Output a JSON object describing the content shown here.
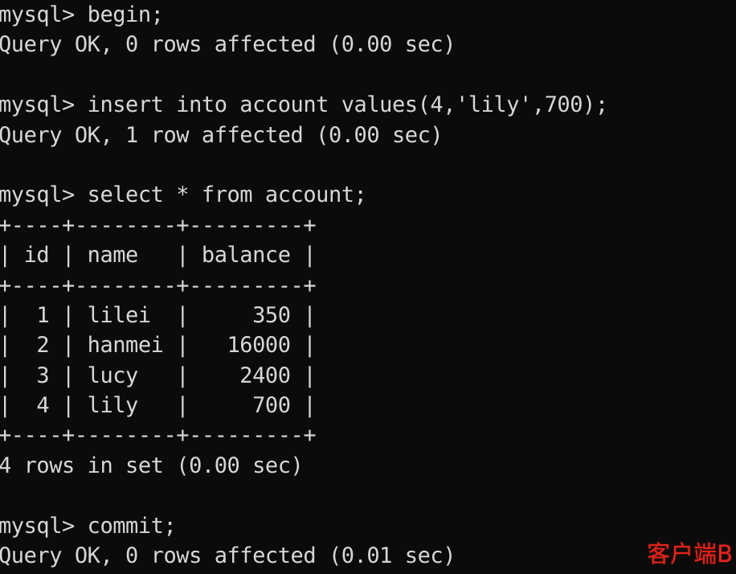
{
  "terminal": {
    "background_color": "#0b0b0b",
    "text_color": "#d6d6d6",
    "prompt": "mysql>",
    "lines": [
      "mysql> begin;",
      "Query OK, 0 rows affected (0.00 sec)",
      "",
      "mysql> insert into account values(4,'lily',700);",
      "Query OK, 1 row affected (0.00 sec)",
      "",
      "mysql> select * from account;",
      "+----+--------+---------+",
      "| id | name   | balance |",
      "+----+--------+---------+",
      "|  1 | lilei  |     350 |",
      "|  2 | hanmei |   16000 |",
      "|  3 | lucy   |    2400 |",
      "|  4 | lily   |     700 |",
      "+----+--------+---------+",
      "4 rows in set (0.00 sec)",
      "",
      "mysql> commit;",
      "Query OK, 0 rows affected (0.01 sec)"
    ],
    "commands": [
      {
        "sql": "begin;",
        "result": "Query OK, 0 rows affected (0.00 sec)"
      },
      {
        "sql": "insert into account values(4,'lily',700);",
        "result": "Query OK, 1 row affected (0.00 sec)"
      },
      {
        "sql": "select * from account;",
        "result": "4 rows in set (0.00 sec)"
      },
      {
        "sql": "commit;",
        "result": "Query OK, 0 rows affected (0.01 sec)"
      }
    ],
    "result_table": {
      "name": "account",
      "columns": [
        "id",
        "name",
        "balance"
      ],
      "rows": [
        [
          "1",
          "lilei",
          "350"
        ],
        [
          "2",
          "hanmei",
          "16000"
        ],
        [
          "3",
          "lucy",
          "2400"
        ],
        [
          "4",
          "lily",
          "700"
        ]
      ],
      "row_count_text": "4 rows in set (0.00 sec)"
    }
  },
  "annotation": {
    "text": "客户端B",
    "color": "#e5241c"
  }
}
